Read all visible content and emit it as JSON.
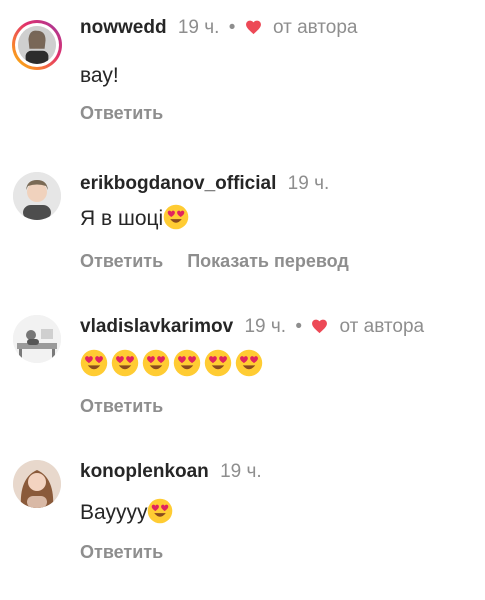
{
  "comments": [
    {
      "username": "nowwedd",
      "time": "19 ч.",
      "liked_by_author": true,
      "author_label": "от автора",
      "separator": "•",
      "text": "вау!",
      "reply_label": "Ответить",
      "avatar_icon": "profile-photo-icon",
      "story_ring": true
    },
    {
      "username": "erikbogdanov_official",
      "time": "19 ч.",
      "liked_by_author": false,
      "text": "Я в шоці",
      "text_emoji": "heart-eyes-emoji",
      "reply_label": "Ответить",
      "translate_label": "Показать перевод",
      "avatar_icon": "profile-photo-icon",
      "story_ring": false
    },
    {
      "username": "vladislavkarimov",
      "time": "19 ч.",
      "liked_by_author": true,
      "author_label": "от автора",
      "separator": "•",
      "text_emoji": "heart-eyes-emoji",
      "emoji_count": 6,
      "reply_label": "Ответить",
      "avatar_icon": "profile-photo-icon",
      "story_ring": false
    },
    {
      "username": "konoplenkoan",
      "time": "19 ч.",
      "liked_by_author": false,
      "text": "Вауууу",
      "text_emoji": "heart-eyes-emoji",
      "reply_label": "Ответить",
      "avatar_icon": "profile-photo-icon",
      "story_ring": false
    }
  ],
  "colors": {
    "text": "#262626",
    "muted": "#8e8e8e",
    "heart": "#ed4956",
    "emoji_face": "#ffcc33",
    "emoji_heart": "#e0245e"
  }
}
